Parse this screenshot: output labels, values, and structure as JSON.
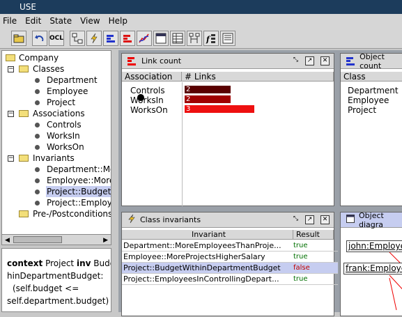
{
  "app": {
    "title": "USE"
  },
  "menu": [
    "File",
    "Edit",
    "State",
    "View",
    "Help"
  ],
  "toolbar": {
    "ocl_label": "OCL"
  },
  "tree": {
    "root": "Company",
    "classes": {
      "label": "Classes",
      "items": [
        "Department",
        "Employee",
        "Project"
      ]
    },
    "associations": {
      "label": "Associations",
      "items": [
        "Controls",
        "WorksIn",
        "WorksOn"
      ]
    },
    "invariants": {
      "label": "Invariants",
      "items": [
        "Department::MoreEmployeesThanProjects",
        "Employee::MoreProjectsHigherSalary",
        "Project::BudgetWithinDepartmentBudget",
        "Project::EmployeesInControllingDepartment"
      ]
    },
    "prepost": {
      "label": "Pre-/Postconditions"
    }
  },
  "tree_display": {
    "inv0": "Department::Mo",
    "inv1": "Employee::More",
    "inv2": "Project::BudgetW",
    "inv3": "Project::Employ"
  },
  "detail": {
    "kw_context": "context",
    "line1_rest": " Project ",
    "kw_inv": "inv",
    "line1_end": " Budg",
    "line2": "hinDepartmentBudget:",
    "line3": "(self.budget <=",
    "line4": "self.department.budget)"
  },
  "link_count": {
    "title": "Link count",
    "col_assoc": "Association",
    "col_links": "# Links",
    "rows": [
      {
        "name": "Controls",
        "links": "2",
        "color": "#5a0000"
      },
      {
        "name": "WorksIn",
        "links": "2",
        "color": "#a00000"
      },
      {
        "name": "WorksOn",
        "links": "3",
        "color": "#ee1010"
      }
    ]
  },
  "object_count": {
    "title": "Object count",
    "col_class": "Class",
    "rows": [
      "Department",
      "Employee",
      "Project"
    ]
  },
  "class_invariants": {
    "title": "Class invariants",
    "col_invariant": "Invariant",
    "col_result": "Result",
    "rows": [
      {
        "name": "Department::MoreEmployeesThanProje...",
        "result": "true",
        "color": "#007000"
      },
      {
        "name": "Employee::MoreProjectsHigherSalary",
        "result": "true",
        "color": "#007000"
      },
      {
        "name": "Project::BudgetWithinDepartmentBudget",
        "result": "false",
        "color": "#c00000"
      },
      {
        "name": "Project::EmployeesInControllingDepart...",
        "result": "true",
        "color": "#007000"
      }
    ]
  },
  "object_diagram": {
    "title": "Object diagra",
    "objects": [
      "john:Employe",
      "frank:Employe"
    ]
  }
}
